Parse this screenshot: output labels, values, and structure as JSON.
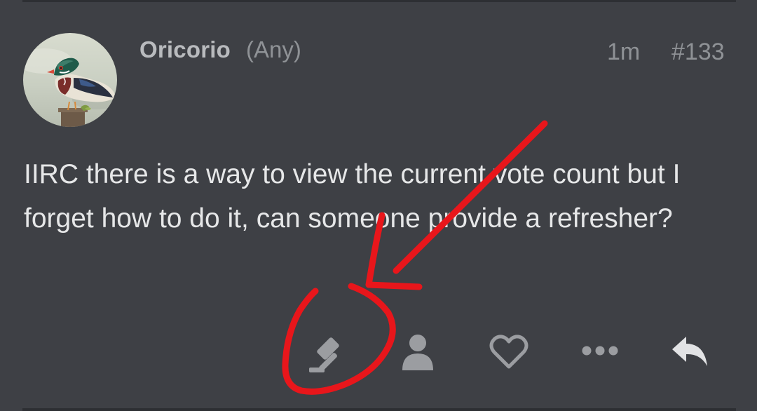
{
  "post": {
    "username": "Oricorio",
    "flair": "(Any)",
    "age": "1m",
    "number": "#133",
    "body": "IIRC there is a way to view the current vote count but I forget how to do it, can someone provide a refresher?"
  },
  "actions": [
    {
      "icon": "gavel-icon"
    },
    {
      "icon": "user-icon"
    },
    {
      "icon": "heart-icon"
    },
    {
      "icon": "more-icon"
    },
    {
      "icon": "reply-icon"
    }
  ],
  "colors": {
    "background": "#3e4045",
    "body_text": "#e6e7e8",
    "muted_text": "#8f9296",
    "icon": "#9b9da1",
    "annotation": "#e8161b"
  }
}
